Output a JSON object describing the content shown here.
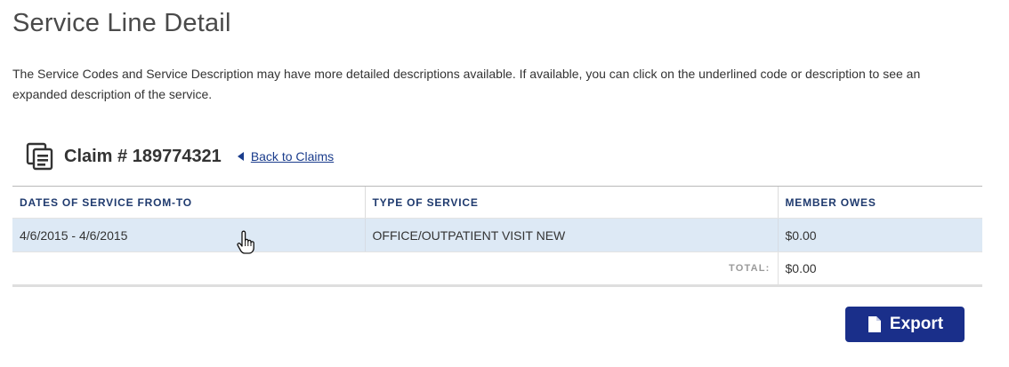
{
  "page": {
    "title": "Service Line Detail",
    "intro": "The Service Codes and Service Description may have more detailed descriptions available. If available, you can click on the underlined code or description to see an expanded description of the service."
  },
  "claim": {
    "label": "Claim # 189774321",
    "back_link": "Back to Claims",
    "icon": "documents-icon"
  },
  "table": {
    "headers": [
      "DATES OF SERVICE FROM-TO",
      "TYPE OF SERVICE",
      "MEMBER OWES"
    ],
    "rows": [
      {
        "dates": "4/6/2015 - 4/6/2015",
        "type": "OFFICE/OUTPATIENT VISIT NEW",
        "owes": "$0.00"
      }
    ],
    "total_label": "TOTAL:",
    "total_value": "$0.00"
  },
  "actions": {
    "export_label": "Export",
    "export_icon": "file-icon"
  },
  "colors": {
    "accent": "#1a2f8a",
    "link": "#1a3c8c",
    "header_text": "#1f3a6e",
    "row_highlight": "#dde9f5"
  }
}
